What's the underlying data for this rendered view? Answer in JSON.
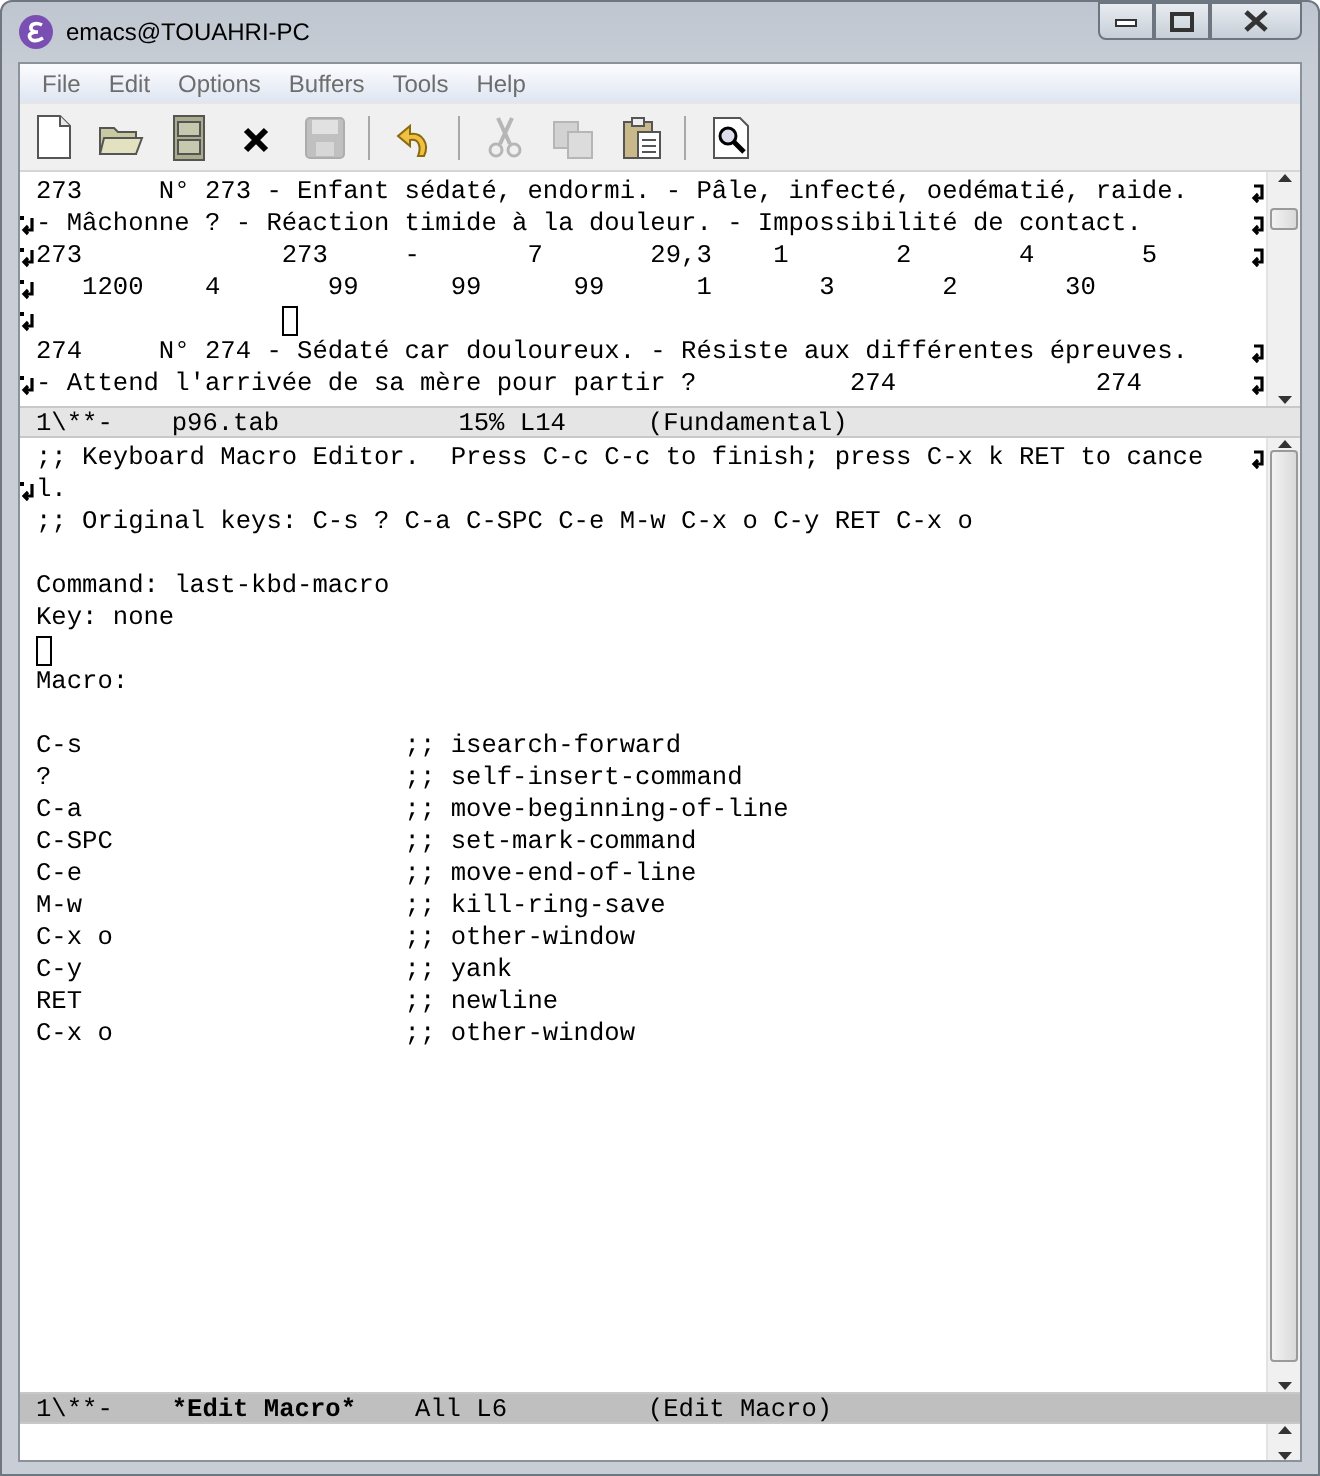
{
  "window": {
    "title": "emacs@TOUAHRI-PC"
  },
  "menu": [
    {
      "label": "File"
    },
    {
      "label": "Edit"
    },
    {
      "label": "Options"
    },
    {
      "label": "Buffers"
    },
    {
      "label": "Tools"
    },
    {
      "label": "Help"
    }
  ],
  "toolbar": [
    {
      "kind": "new",
      "disabled": false
    },
    {
      "kind": "open",
      "disabled": false
    },
    {
      "kind": "dired",
      "disabled": false
    },
    {
      "kind": "close",
      "disabled": false
    },
    {
      "kind": "save",
      "disabled": true
    },
    {
      "kind": "sep"
    },
    {
      "kind": "undo",
      "disabled": false
    },
    {
      "kind": "sep"
    },
    {
      "kind": "cut",
      "disabled": true
    },
    {
      "kind": "copy",
      "disabled": true
    },
    {
      "kind": "paste",
      "disabled": false
    },
    {
      "kind": "sep"
    },
    {
      "kind": "search",
      "disabled": false
    }
  ],
  "top_window": {
    "lines": [
      {
        "text": "273     N° 273 - Enfant sédaté, endormi. - Pâle, infecté, oedématié, raide.",
        "wrap_right": true
      },
      {
        "text": "- Mâchonne ? - Réaction timide à la douleur. - Impossibilité de contact.",
        "wrap_left": true,
        "wrap_right": true
      },
      {
        "text": "273             273     -       7       29,3    1       2       4       5",
        "wrap_left": true,
        "wrap_right": true
      },
      {
        "text": "   1200    4       99      99      99      1       3       2       30",
        "wrap_left": true
      },
      {
        "wrap_left": true,
        "cursor": true
      },
      {
        "text": "274     N° 274 - Sédaté car douloureux. - Résiste aux différentes épreuves.",
        "wrap_right": true
      },
      {
        "text": "- Attend l'arrivée de sa mère pour partir ?          274             274",
        "wrap_left": true,
        "wrap_right": true
      }
    ],
    "mode_line": {
      "active": false,
      "status": "1\\**-",
      "buffer": "p96.tab",
      "position": "15% L14",
      "mode": "(Fundamental)"
    }
  },
  "bottom_window": {
    "lines": [
      {
        "text": ";; Keyboard Macro Editor.  Press C-c C-c to finish; press C-x k RET to cance",
        "wrap_right": true
      },
      {
        "text": "l.",
        "wrap_left": true
      },
      {
        "text": ";; Original keys: C-s ? C-a C-SPC C-e M-w C-x o C-y RET C-x o"
      },
      {
        "blank": true
      },
      {
        "text": "Command: last-kbd-macro"
      },
      {
        "text": "Key: none"
      },
      {
        "cursor": true
      },
      {
        "text": "Macro:"
      },
      {
        "blank": true
      },
      {
        "text": "C-s                     ;; isearch-forward"
      },
      {
        "text": "?                       ;; self-insert-command"
      },
      {
        "text": "C-a                     ;; move-beginning-of-line"
      },
      {
        "text": "C-SPC                   ;; set-mark-command"
      },
      {
        "text": "C-e                     ;; move-end-of-line"
      },
      {
        "text": "M-w                     ;; kill-ring-save"
      },
      {
        "text": "C-x o                   ;; other-window"
      },
      {
        "text": "C-y                     ;; yank"
      },
      {
        "text": "RET                     ;; newline"
      },
      {
        "text": "C-x o                   ;; other-window"
      }
    ],
    "mode_line": {
      "active": true,
      "status": "1\\**-",
      "buffer": "*Edit Macro*",
      "position": "All L6",
      "mode": "(Edit Macro)"
    }
  }
}
